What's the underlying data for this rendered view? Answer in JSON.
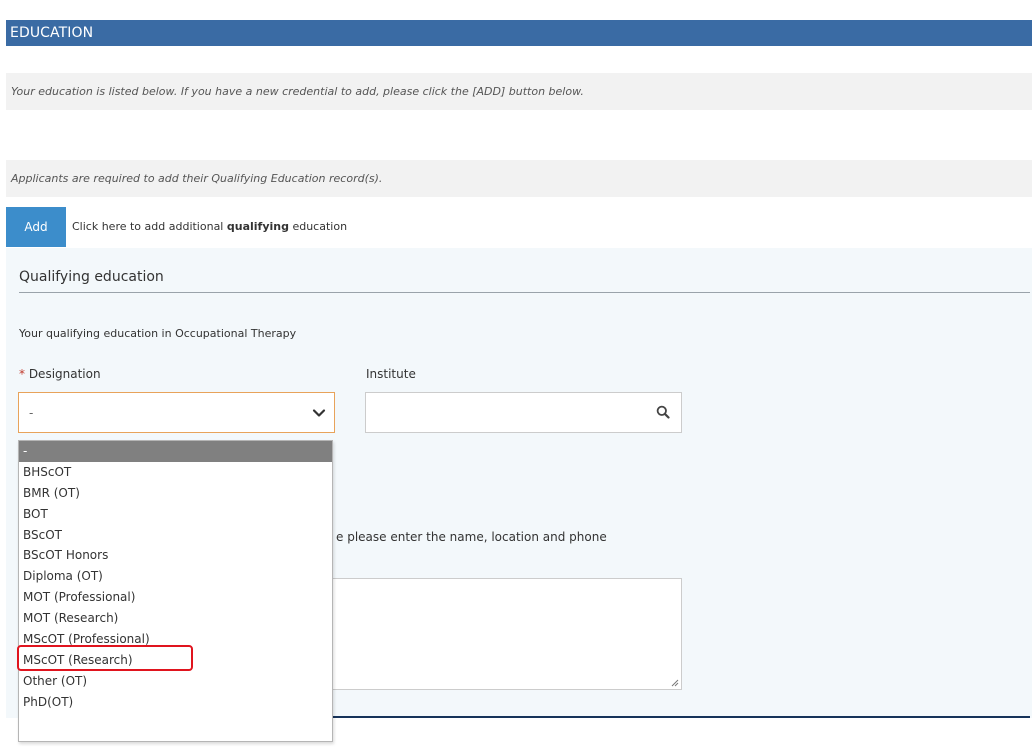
{
  "section": {
    "title": "EDUCATION"
  },
  "notices": {
    "listed": "Your education is listed below. If you have a new credential to add, please click the [ADD] button below.",
    "required": "Applicants are required to add their Qualifying Education record(s)."
  },
  "add": {
    "button_label": "Add",
    "hint_prefix": "Click here to add additional ",
    "hint_bold": "qualifying",
    "hint_suffix": " education"
  },
  "form": {
    "panel_title": "Qualifying education",
    "subtitle": "Your qualifying education in Occupational Therapy",
    "designation": {
      "required_mark": "*",
      "label": " Designation",
      "value": "-",
      "options": [
        "-",
        "BHScOT",
        "BMR (OT)",
        "BOT",
        "BScOT",
        "BScOT Honors",
        "Diploma (OT)",
        "MOT (Professional)",
        "MOT (Research)",
        "MScOT (Professional)",
        "MScOT (Research)",
        "Other (OT)",
        "PhD(OT)"
      ],
      "selected_option": "-",
      "highlighted_option": "MScOT (Professional)"
    },
    "institute": {
      "label": "Institute",
      "value": ""
    },
    "other_institute_text": "e please enter the name, location and phone"
  },
  "icons": {
    "dropdown": "chevron-down-icon",
    "search": "search-icon",
    "resize": "resize-handle-icon"
  },
  "colors": {
    "header": "#3a6ba4",
    "add_button": "#3c8dcb",
    "required": "#c0392b",
    "focus_border": "#e8a35a",
    "highlight": "#e0141e",
    "selected_option": "#808080"
  }
}
